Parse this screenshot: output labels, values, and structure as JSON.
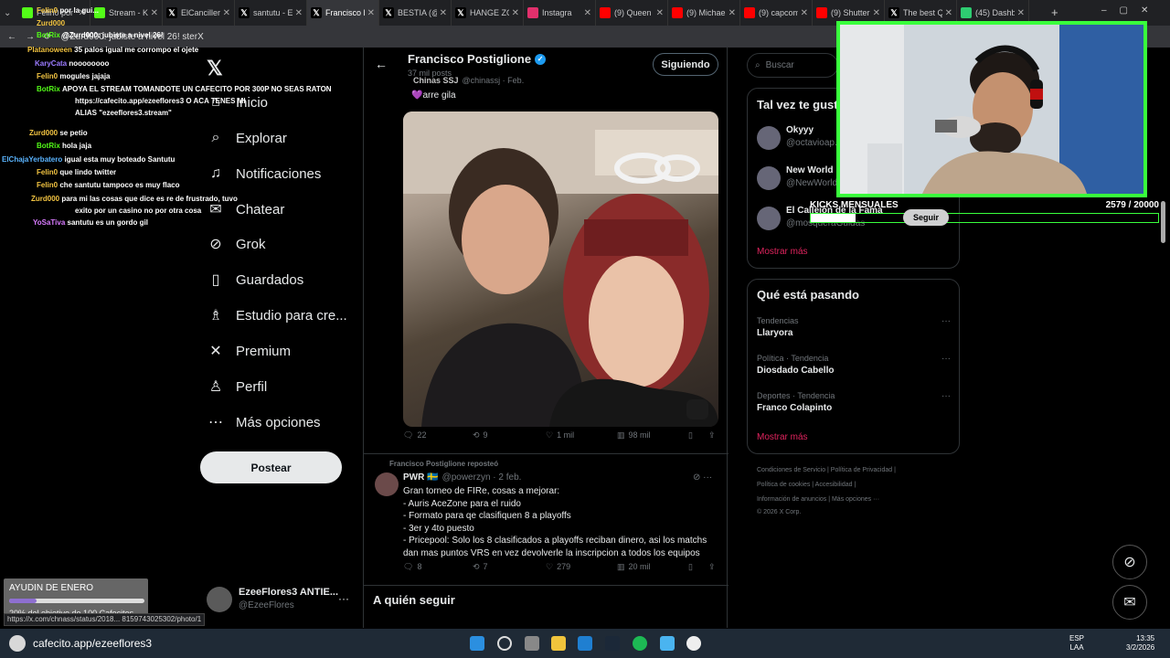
{
  "browser": {
    "tabs": [
      {
        "label": "Felin0 por la gui...",
        "color": "#53fc18"
      },
      {
        "label": "Stream - Ki",
        "color": "#53fc18"
      },
      {
        "label": "ElCancillerA",
        "color": "#ffffff"
      },
      {
        "label": "santutu - E",
        "color": "#ffffff"
      },
      {
        "label": "Francisco P",
        "color": "#ffffff"
      },
      {
        "label": "BESTIA (@t",
        "color": "#ffffff"
      },
      {
        "label": "HANGE ZO",
        "color": "#ffffff"
      },
      {
        "label": "Instagra",
        "color": "#e1306c"
      },
      {
        "label": "(9) Queen",
        "color": "#ff0000"
      },
      {
        "label": "(9) Michael",
        "color": "#ff0000"
      },
      {
        "label": "(9) capcom",
        "color": "#ff0000"
      },
      {
        "label": "(9) Shutter",
        "color": "#ff0000"
      },
      {
        "label": "The best Q",
        "color": "#ffffff"
      },
      {
        "label": "(45) Dashb",
        "color": "#2ecc71"
      }
    ],
    "active_tab_index": 4,
    "url_text": "@Zurd000: jubiste a nivel 26! sterX",
    "status_link": "https://x.com/chnass/status/2018... 8159743025302/photo/1"
  },
  "chat": [
    {
      "user": "Felin0",
      "color": "#f4c542",
      "msg": "por la gui..."
    },
    {
      "user": "Zurd000",
      "color": "#f4c542",
      "msg": ""
    },
    {
      "user": "BotRix",
      "color": "#53fc18",
      "msg": "@Zurd000: jubiste a nivel 26!"
    },
    {
      "user": "Platanoween",
      "color": "#f4c542",
      "msg": "35 palos igual me corrompo el ojete"
    },
    {
      "user": "KaryCata",
      "color": "#9b7bff",
      "msg": "noooooooo"
    },
    {
      "user": "Felin0",
      "color": "#f4c542",
      "msg": "mogules jajaja"
    },
    {
      "user": "BotRix",
      "color": "#53fc18",
      "msg": "APOYA EL STREAM TOMANDOTE UN CAFECITO POR 300P NO SEAS RATON"
    },
    {
      "user": "",
      "color": "#fff",
      "msg": "https://cafecito.app/ezeeflores3 O ACA TENES MI"
    },
    {
      "user": "",
      "color": "#fff",
      "msg": "ALIAS \"ezeeflores3.stream\""
    },
    {
      "user": "Zurd000",
      "color": "#f4c542",
      "msg": "se petio"
    },
    {
      "user": "BotRix",
      "color": "#53fc18",
      "msg": "hola jaja"
    },
    {
      "user": "ElChajaYerbatero",
      "color": "#5ab4ff",
      "msg": "igual esta muy boteado Santutu"
    },
    {
      "user": "Felin0",
      "color": "#f4c542",
      "msg": "que lindo twitter"
    },
    {
      "user": "Felin0",
      "color": "#f4c542",
      "msg": "che santutu tampoco es muy flaco"
    },
    {
      "user": "Zurd000",
      "color": "#f4c542",
      "msg": "para mi las cosas que dice es re de frustrado, tuvo"
    },
    {
      "user": "",
      "color": "#fff",
      "msg": "exito por un casino no por otra cosa"
    },
    {
      "user": "YoSaTiva",
      "color": "#d97bff",
      "msg": "santutu es un gordo gil"
    }
  ],
  "nav": {
    "items": [
      {
        "label": "Inicio",
        "icon": "home-icon",
        "glyph": "⌂"
      },
      {
        "label": "Explorar",
        "icon": "search-icon",
        "glyph": "⌕"
      },
      {
        "label": "Notificaciones",
        "icon": "bell-icon",
        "glyph": "♫"
      },
      {
        "label": "Chatear",
        "icon": "mail-icon",
        "glyph": "✉"
      },
      {
        "label": "Grok",
        "icon": "grok-icon",
        "glyph": "⊘"
      },
      {
        "label": "Guardados",
        "icon": "bookmark-icon",
        "glyph": "▯"
      },
      {
        "label": "Estudio para cre...",
        "icon": "flask-icon",
        "glyph": "♗"
      },
      {
        "label": "Premium",
        "icon": "x-logo-icon",
        "glyph": "✕"
      },
      {
        "label": "Perfil",
        "icon": "person-icon",
        "glyph": "♙"
      },
      {
        "label": "Más opciones",
        "icon": "more-circle-icon",
        "glyph": "⋯"
      }
    ],
    "post_label": "Postear",
    "account_name": "EzeeFlores3 ANTIE...",
    "account_handle": "@EzeeFlores"
  },
  "profile": {
    "name": "Francisco Postiglione",
    "posts_count": "37 mil posts",
    "follow_label": "Siguiendo"
  },
  "quoted": {
    "name": "Chinas SSJ",
    "handle": "@chinassj · Feb.",
    "text": "💜arre gila"
  },
  "tweet1": {
    "replies": "22",
    "reposts": "9",
    "likes": "1 mil",
    "views": "98 mil"
  },
  "tweet2": {
    "reposted_by": "Francisco Postiglione reposteó",
    "name": "PWR 🇸🇪",
    "handle": "@powerzyn · 2 feb.",
    "lines": [
      "Gran torneo de FIRe, cosas a mejorar:",
      "- Auris AceZone para el ruido",
      "- Formato para qe clasifiquen 8 a playoffs",
      "- 3er y 4to puesto",
      "- Pricepool: Solo los 8 clasificados a playoffs reciban dinero, asi los matchs",
      "dan mas puntos VRS en vez devolverle la inscripcion a todos los equipos"
    ],
    "replies": "8",
    "reposts": "7",
    "likes": "279",
    "views": "20 mil"
  },
  "who_to_follow_heading": "A quién seguir",
  "search_placeholder": "Buscar",
  "suggest": {
    "title": "Tal vez te gust...",
    "users": [
      {
        "name": "Okyyy",
        "handle": "@octavioap..."
      },
      {
        "name": "New World",
        "handle": "@NewWorld..."
      },
      {
        "name": "El Callejón de la Fama",
        "handle": "@mosqueraGuidas"
      }
    ],
    "follow_label": "Seguir",
    "more": "Mostrar más"
  },
  "trends": {
    "title": "Qué está pasando",
    "items": [
      {
        "context": "Tendencias",
        "name": "Llaryora"
      },
      {
        "context": "Política · Tendencia",
        "name": "Diosdado Cabello"
      },
      {
        "context": "Deportes · Tendencia",
        "name": "Franco Colapinto"
      }
    ],
    "more": "Mostrar más"
  },
  "footer": {
    "row1": "Condiciones de Servicio  |  Política de Privacidad  |",
    "row2": "Política de cookies  |  Accesibilidad  |",
    "row3": "Información de anuncios  |  Más opciones ···",
    "row4": "© 2026 X Corp."
  },
  "overlay": {
    "kicks_label": "KICKS MENSUALES",
    "kicks_value": "2579  / 20000",
    "kicks_fraction": 0.129,
    "ayudin_title": "AYUDIN DE ENERO",
    "ayudin_text": "20% del objetivo de 100 Cafecitos",
    "ayudin_fraction": 0.2
  },
  "taskbar": {
    "browser_label": "cafecito.app/ezeeflores3",
    "lang": "ESP",
    "lang2": "LAA",
    "time": "13:35",
    "date": "3/2/2026"
  }
}
